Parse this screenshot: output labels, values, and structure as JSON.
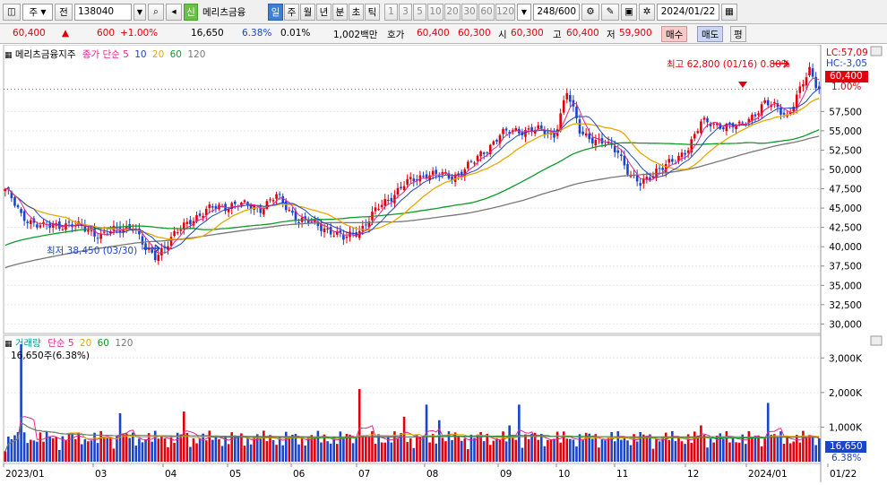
{
  "toolbar": {
    "market": "주",
    "prev": "전",
    "code": "138040",
    "credit_badge": "신",
    "stock_name": "메리츠금융",
    "periods": [
      "일",
      "주",
      "월",
      "년",
      "분",
      "초",
      "틱"
    ],
    "active_period": "일",
    "intervals": [
      "1",
      "3",
      "5",
      "10",
      "20",
      "30",
      "60",
      "120"
    ],
    "count": "248/600",
    "date": "2024/01/22"
  },
  "pricebar": {
    "price": "60,400",
    "change": "600",
    "change_pct": "+1.00%",
    "volume": "16,650",
    "volume_pct": "6.38%",
    "turnover_pct": "0.01%",
    "amount": "1,002백만",
    "ask_label": "호가",
    "ask": "60,400",
    "bid": "60,300",
    "open_label": "시",
    "open": "60,300",
    "high_label": "고",
    "high": "60,400",
    "low_label": "저",
    "low": "59,900",
    "buy_label": "매수",
    "sell_label": "매도",
    "avg_label": "평"
  },
  "legend": {
    "price_title": "메리츠금융지주",
    "price_type": "종가 단순",
    "ma_periods": [
      "5",
      "10",
      "20",
      "60",
      "120"
    ],
    "volume_title": "거래량",
    "volume_type": "단순",
    "volume_ma_periods": [
      "5",
      "20",
      "60",
      "120"
    ],
    "volume_readout": "16,650주(6.38%)"
  },
  "annotations": {
    "lc": "LC:57,09",
    "hc": "HC:-3,05",
    "last_price": "60,400",
    "last_pct": "1.00%",
    "high_marker": "최고 62,800 (01/16)",
    "high_marker_tail": "0.80%",
    "low_marker": "최저 38,450 (03/30)",
    "vol_last": "16,650",
    "vol_last_pct": "6.38%"
  },
  "colors": {
    "up": "#e0000d",
    "down": "#1a45c8",
    "ma5": "#e0288c",
    "ma10": "#1a45c8",
    "ma20": "#e6a800",
    "ma60": "#0e9a2a",
    "ma120": "#777777"
  },
  "chart_data": {
    "type": "candlestick",
    "price_axis": {
      "min": 30000,
      "max": 57500,
      "ticks": [
        "57,500",
        "55,000",
        "52,500",
        "50,000",
        "47,500",
        "45,000",
        "42,500",
        "40,000",
        "37,500",
        "35,000",
        "32,500",
        "30,000"
      ]
    },
    "volume_axis": {
      "ticks": [
        "3,000K",
        "2,000K",
        "1,000K"
      ]
    },
    "x_labels": [
      "2023/01",
      "03",
      "04",
      "05",
      "06",
      "07",
      "08",
      "09",
      "10",
      "11",
      "12",
      "2024/01",
      "01/22"
    ],
    "close_anchors": [
      [
        0,
        47500
      ],
      [
        5,
        44000
      ],
      [
        12,
        42500
      ],
      [
        20,
        43000
      ],
      [
        30,
        41500
      ],
      [
        40,
        42800
      ],
      [
        44,
        39500
      ],
      [
        47,
        38800
      ],
      [
        52,
        41000
      ],
      [
        58,
        43500
      ],
      [
        65,
        45000
      ],
      [
        72,
        45500
      ],
      [
        80,
        45000
      ],
      [
        85,
        46500
      ],
      [
        92,
        43500
      ],
      [
        100,
        42500
      ],
      [
        106,
        41000
      ],
      [
        112,
        42500
      ],
      [
        118,
        45500
      ],
      [
        125,
        48000
      ],
      [
        132,
        49500
      ],
      [
        140,
        49000
      ],
      [
        147,
        51000
      ],
      [
        155,
        54500
      ],
      [
        160,
        55000
      ],
      [
        165,
        55200
      ],
      [
        172,
        54500
      ],
      [
        176,
        60000
      ],
      [
        180,
        55000
      ],
      [
        186,
        53500
      ],
      [
        192,
        52500
      ],
      [
        196,
        49000
      ],
      [
        199,
        48000
      ],
      [
        204,
        50000
      ],
      [
        210,
        51000
      ],
      [
        214,
        53000
      ],
      [
        218,
        56000
      ],
      [
        224,
        55800
      ],
      [
        230,
        55500
      ],
      [
        234,
        57000
      ],
      [
        238,
        58500
      ],
      [
        242,
        58000
      ],
      [
        245,
        57000
      ],
      [
        248,
        59300
      ],
      [
        252,
        62800
      ],
      [
        255,
        60400
      ]
    ],
    "volume_range": [
      250000,
      3500000
    ]
  }
}
